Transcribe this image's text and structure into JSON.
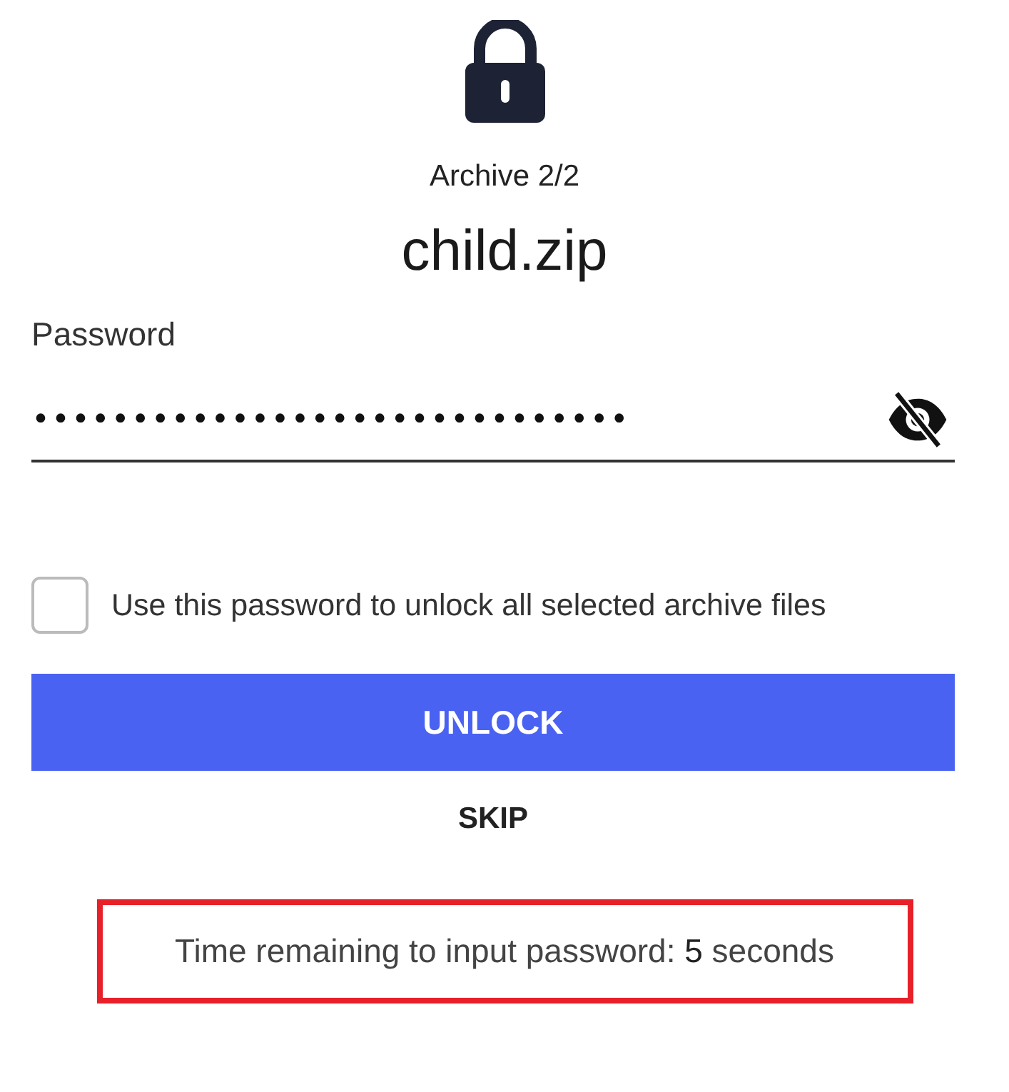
{
  "archive_counter": "Archive 2/2",
  "file_name": "child.zip",
  "password_field": {
    "label": "Password",
    "value": "••••••••••••••••••••••••••••••",
    "visible": false
  },
  "apply_to_all": {
    "label": "Use this password to unlock all selected archive files",
    "checked": false
  },
  "buttons": [
    {
      "kind": "primary",
      "label": "UNLOCK"
    },
    {
      "kind": "text",
      "label": "SKIP"
    }
  ],
  "timer": {
    "text": "Time remaining to input password: **5** seconds",
    "highlighted": true
  }
}
